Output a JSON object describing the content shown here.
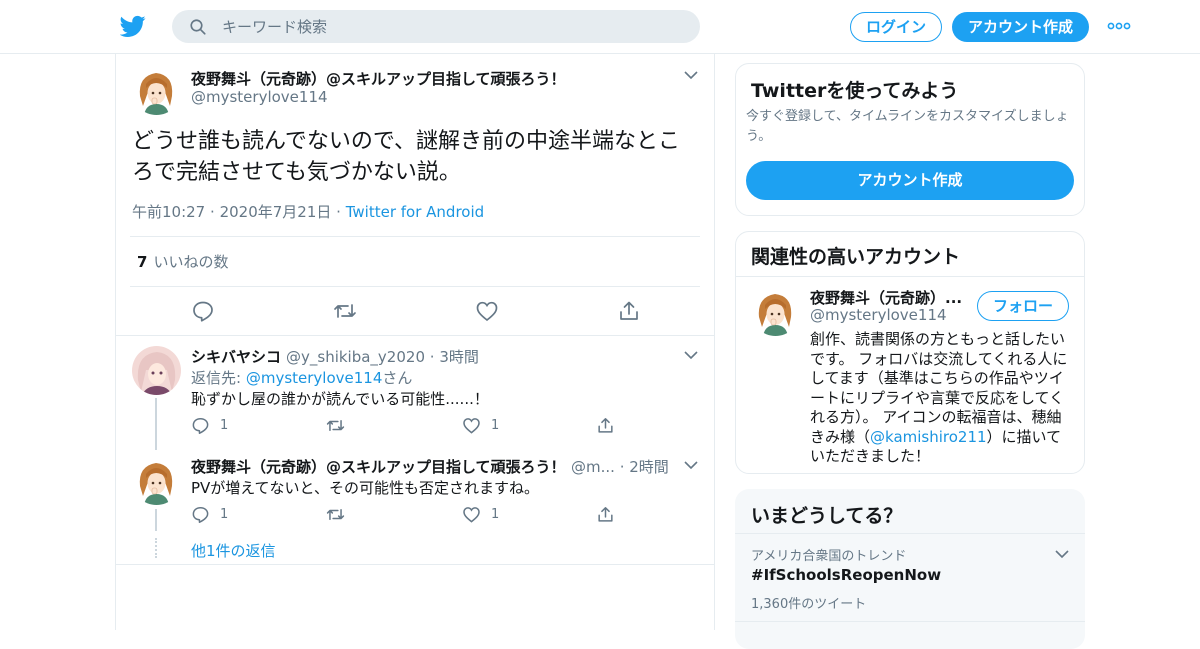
{
  "header": {
    "logo_icon": "twitter-bird-icon",
    "search_placeholder": "キーワード検索",
    "login_label": "ログイン",
    "signup_label": "アカウント作成",
    "more_icon": "more-dots-icon",
    "accent_color": "#1da1f2"
  },
  "main_tweet": {
    "name": "夜野舞斗（元奇跡）@スキルアップ目指して頑張ろう！",
    "handle": "@mysterylove114",
    "text": "どうせ誰も読んでないので、謎解き前の中途半端なところで完結させても気づかない説。",
    "time": "午前10:27",
    "date": "2020年7月21日",
    "source": "Twitter for Android",
    "sep": "·",
    "like_count": "7",
    "like_label": "いいねの数"
  },
  "replies": [
    {
      "name": "シキバヤシコ",
      "handle": "@y_shikiba_y2020",
      "sep": "·",
      "time": "3時間",
      "reply_to_prefix": "返信先:",
      "reply_to_user": "@mysterylove114",
      "reply_to_suffix": "さん",
      "text": "恥ずかし屋の誰かが読んでいる可能性......！",
      "reply_count": "1",
      "like_count": "1"
    },
    {
      "name": "夜野舞斗（元奇跡）@スキルアップ目指して頑張ろう！",
      "handle": "@m...",
      "sep": "·",
      "time": "2時間",
      "text": "PVが増えてないと、その可能性も否定されますね。",
      "reply_count": "1",
      "like_count": "1"
    }
  ],
  "more_replies_label": "他1件の返信",
  "sidebar": {
    "signup_card": {
      "title": "Twitterを使ってみよう",
      "subtitle": "今すぐ登録して、タイムラインをカスタマイズしましょう。",
      "button": "アカウント作成"
    },
    "related_card": {
      "title": "関連性の高いアカウント",
      "name": "夜野舞斗（元奇跡）...",
      "handle": "@mysterylove114",
      "follow_label": "フォロー",
      "bio_before": "創作、読書関係の方ともっと話したいです。 フォロバは交流してくれる人にしてます（基準はこちらの作品やツイートにリプライや言葉で反応をしてくれる方）。 アイコンの転福音は、穂紬きみ様（",
      "bio_link": "@kamishiro211",
      "bio_after": "）に描いていただきました！"
    },
    "trends_card": {
      "title": "いまどうしてる？",
      "context": "アメリカ合衆国のトレンド",
      "tag": "#IfSchoolsReopenNow",
      "count": "1,360件のツイート"
    }
  }
}
